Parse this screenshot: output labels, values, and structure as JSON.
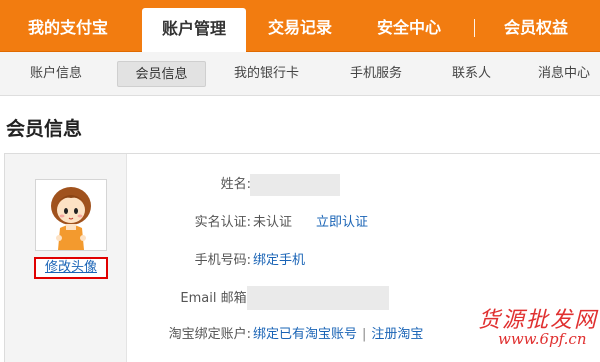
{
  "top_nav": {
    "tabs": [
      "我的支付宝",
      "账户管理",
      "交易记录",
      "安全中心",
      "会员权益"
    ],
    "active_tab": "账户管理"
  },
  "sub_nav": {
    "items": [
      "账户信息",
      "会员信息",
      "我的银行卡",
      "手机服务",
      "联系人",
      "消息中心"
    ],
    "active_item": "会员信息"
  },
  "page": {
    "title": "会员信息"
  },
  "avatar": {
    "edit_label": "修改头像"
  },
  "fields": {
    "name_label": "姓名:",
    "realname_label": "实名认证:",
    "realname_status": "未认证",
    "realname_action": "立即认证",
    "phone_label": "手机号码:",
    "phone_action": "绑定手机",
    "email_label": "Email 邮箱:",
    "taobao_label": "淘宝绑定账户:",
    "taobao_bind": "绑定已有淘宝账号",
    "taobao_divider": "|",
    "taobao_register": "注册淘宝"
  },
  "watermark": {
    "line1": "货源批发网",
    "line2": "www.6pf.cn"
  },
  "colors": {
    "nav_orange": "#f27c10",
    "link_blue": "#1a64b6",
    "highlight_red": "#e00000"
  }
}
